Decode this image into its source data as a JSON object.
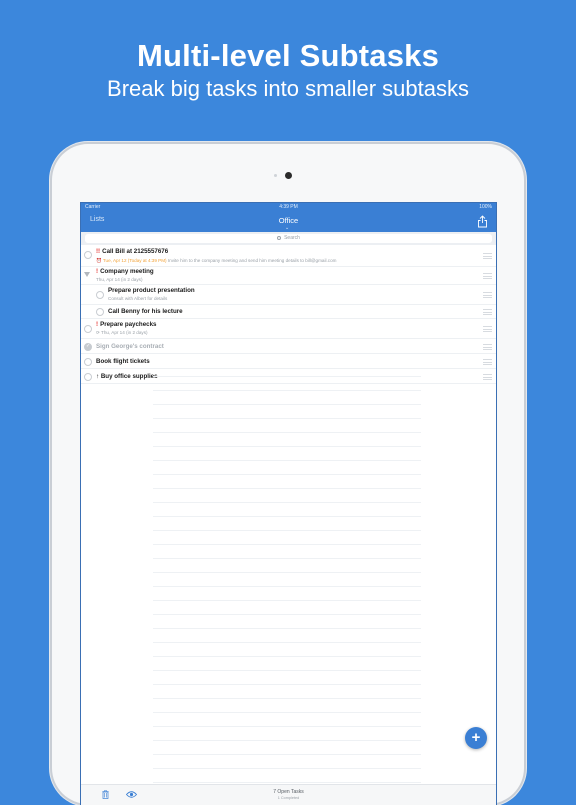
{
  "promo": {
    "headline": "Multi-level Subtasks",
    "subheadline": "Break big tasks into smaller subtasks"
  },
  "status_bar": {
    "carrier": "Carrier",
    "time": "4:39 PM",
    "battery": "100%"
  },
  "nav": {
    "back_label": "Lists",
    "title": "Office"
  },
  "search": {
    "placeholder": "Search"
  },
  "tasks": [
    {
      "title": "Call Bill at 2125557676",
      "priority": "!!",
      "due": "Tue, Apr 12 (Today at 4:39 PM)",
      "note": "Invite him to the company meeting and send him meeting details to bill@gmail.com"
    },
    {
      "title": "Company meeting",
      "priority": "!",
      "due_meta": "Thu, Apr 14 (in 2 days)"
    },
    {
      "title": "Prepare product presentation",
      "note": "Consult with Albert for details"
    },
    {
      "title": "Call Benny for his lecture"
    },
    {
      "title": "Prepare paychecks",
      "priority": "!",
      "due_meta": "Thu, Apr 14 (in 2 days)"
    },
    {
      "title": "Sign George's contract"
    },
    {
      "title": "Book flight tickets"
    },
    {
      "title": "Buy office supplies",
      "prefix": "↑"
    }
  ],
  "footer": {
    "open_tasks": "7 Open Tasks",
    "completed": "1 Completed"
  },
  "colors": {
    "background": "#3c87dc",
    "accent": "#3a7fd4",
    "priority": "#e53935",
    "due_today": "#f2a33a"
  }
}
